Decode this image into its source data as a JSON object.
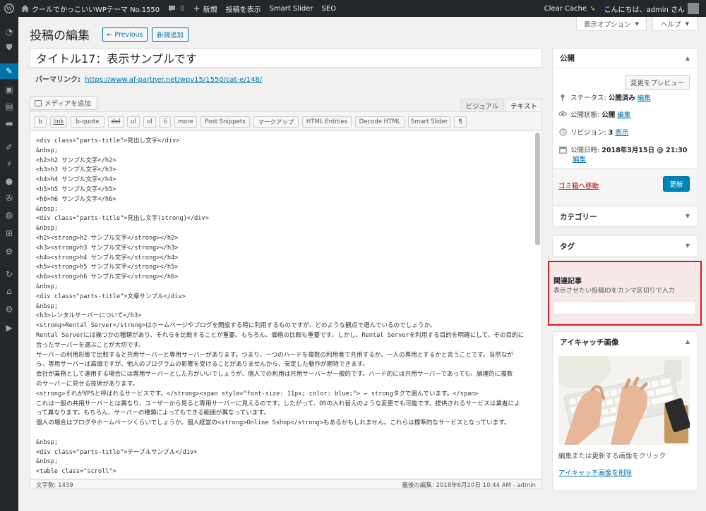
{
  "adminbar": {
    "site_name": "クールでかっこいいWPテーマ No.1550",
    "comments_count": "0",
    "new_label": "新規",
    "view_post": "投稿を表示",
    "smart_slider": "Smart Slider",
    "seo": "SEO",
    "clear_cache": "Clear Cache",
    "greeting": "こんにちは、admin さん"
  },
  "header": {
    "title": "投稿の編集",
    "previous": "← Previous",
    "add_new": "新規追加",
    "screen_options": "表示オプション",
    "help": "ヘルプ"
  },
  "post": {
    "title": "タイトル17：表示サンプルです",
    "permalink_label": "パーマリンク:",
    "permalink_url": "https://www.af-partner.net/wpv15/1550/cat-e/148/"
  },
  "editor": {
    "add_media": "メディアを追加",
    "tab_visual": "ビジュアル",
    "tab_text": "テキスト",
    "quicktags": [
      "b",
      "link",
      "b-quote",
      "del",
      "ul",
      "ol",
      "li",
      "more",
      "Post Snippets",
      "マークアップ",
      "HTML Entities",
      "Decode HTML",
      "Smart Slider",
      "¶"
    ],
    "lines": [
      "<div class=\"parts-title\">見出し文字</div>",
      "&nbsp;",
      "<h2>h2 サンプル文字</h2>",
      "<h3>h3 サンプル文字</h3>",
      "<h4>h4 サンプル文字</h4>",
      "<h5>h5 サンプル文字</h5>",
      "<h6>h6 サンプル文字</h6>",
      "&nbsp;",
      "<div class=\"parts-title\">見出し文字(strong)</div>",
      "&nbsp;",
      "<h2><strong>h2 サンプル文字</strong></h2>",
      "<h3><strong>h3 サンプル文字</strong></h3>",
      "<h4><strong>h4 サンプル文字</strong></h4>",
      "<h5><strong>h5 サンプル文字</strong></h5>",
      "<h6><strong>h6 サンプル文字</strong></h6>",
      "&nbsp;",
      "<div class=\"parts-title\">文章サンプル</div>",
      "&nbsp;",
      "<h3>レンタルサーバーについて</h3>",
      "<strong>Rental Server</strong>はホームページやブログを開設する時に利用するものですが、どのような観点で選んでいるのでしょうか。",
      "Rental Serverには幾つかの種類があり、それらを比較することが重要。もちろん、価格の比較も重要です。しかし、Rental Serverを利用する目的を明確にして、その目的に",
      "合ったサーバーを選ぶことが大切です。",
      "サーバーの利用形態で比較すると共用サーバーと専用サーバーがあります。つまり、一つのハードを複数の利用者で共用するか、一人の専用とするかと言うことです。当然なが",
      "ら、専用サーバーは高価ですが、他人のプログラムの影響を受けることがありませんから、安定した動作が期待できます。",
      "会社が業務として運用する場合には専用サーバーとした方がいいでしょうが、個人での利用は共用サーバーが一般的です。ハード的には共用サーバーであっても、論理的に複数",
      "のサーバーに見せる技術があります。",
      "<strong>それがVPSと呼ばれるサービスです。</strong><span style=\"font-size: 11px; color: blue;\"> ← strongタグで囲んでいます。</span>",
      "これは一般の共用サーバーとは異なり、ユーザーから見ると専用サーバーに見えるのです。したがって、OSの入れ替えのような変更でも可能です。提供されるサービスは業者によ",
      "って異なります。もちろん、サーバーの種類によってもできる範囲が異なっています。",
      "個人の場合はブログやホームページくらいでしょうか。個人経営の<strong>Online Sshop</strong>もあるかもしれません。これらは標準的なサービスとなっています。",
      "",
      "&nbsp;",
      "<div class=\"parts-title\">テーブルサンプル</div>",
      "&nbsp;",
      "<table class=\"scroll\">"
    ],
    "word_count": "文字数: 1439",
    "last_edit": "最後の編集: 2018年6月20日 10:44 AM - admin"
  },
  "publish": {
    "title": "公開",
    "preview": "変更をプレビュー",
    "status_label": "ステータス:",
    "status_value": "公開済み",
    "visibility_label": "公開状態:",
    "visibility_value": "公開",
    "revision_label": "リビジョン:",
    "revision_value": "3",
    "revision_link": "表示",
    "date_label": "公開日時:",
    "date_value": "2018年3月15日 @ 21:30",
    "edit_link": "編集",
    "trash": "ゴミ箱へ移動",
    "update": "更新"
  },
  "category": {
    "title": "カテゴリー"
  },
  "tags": {
    "title": "タグ"
  },
  "related": {
    "title": "関連記事",
    "description": "表示させたい投稿IDをカンマ区切りで入力",
    "value": ""
  },
  "eyecatch": {
    "title": "アイキャッチ画像",
    "desc": "編集または更新する画像をクリック",
    "remove": "アイキャッチ画像を削除"
  },
  "colors": {
    "admin_bar": "#23282d",
    "accent": "#0073aa",
    "primary_button": "#0085ba",
    "highlight_border": "#e0191e",
    "trash": "#a00"
  },
  "icons": [
    "wordpress-logo",
    "home-icon",
    "comment-icon",
    "plus-icon",
    "avatar",
    "pin-icon",
    "eye-icon",
    "history-icon",
    "calendar-icon"
  ]
}
